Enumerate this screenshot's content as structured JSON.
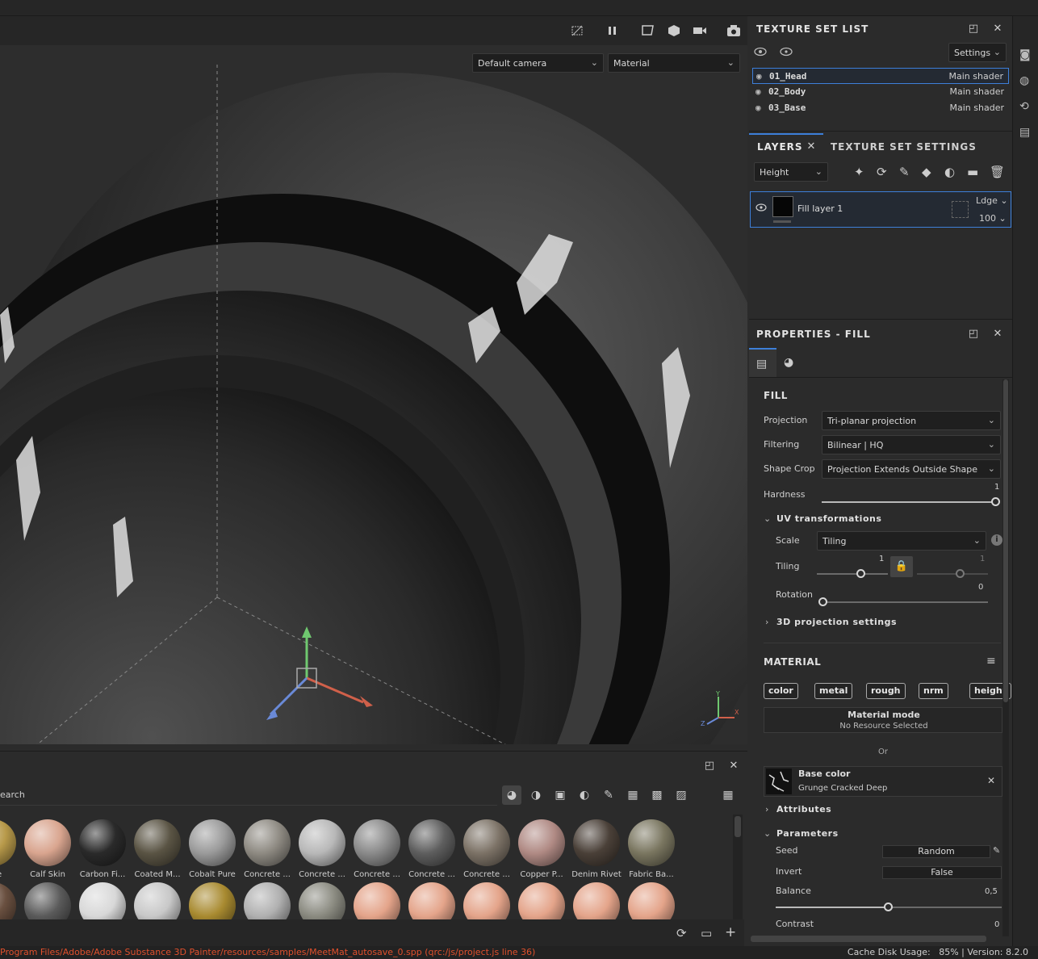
{
  "viewport": {
    "camera_select": "Default camera",
    "mode_select": "Material"
  },
  "texture_set_list": {
    "title": "TEXTURE SET LIST",
    "settings_label": "Settings",
    "rows": [
      {
        "name": "01_Head",
        "shader": "Main shader"
      },
      {
        "name": "02_Body",
        "shader": "Main shader"
      },
      {
        "name": "03_Base",
        "shader": "Main shader"
      }
    ]
  },
  "layers": {
    "tab_layers": "LAYERS",
    "tab_settings": "TEXTURE SET SETTINGS",
    "channel_select": "Height",
    "layer": {
      "name": "Fill layer 1",
      "blend": "Ldge",
      "opacity": "100"
    }
  },
  "properties": {
    "title": "PROPERTIES - FILL",
    "fill_heading": "FILL",
    "projection_label": "Projection",
    "projection_value": "Tri-planar projection",
    "filtering_label": "Filtering",
    "filtering_value": "Bilinear | HQ",
    "shape_crop_label": "Shape Crop",
    "shape_crop_value": "Projection Extends Outside Shape",
    "hardness_label": "Hardness",
    "hardness_value": "1",
    "hardness_level": 1.0,
    "uv_heading": "UV transformations",
    "scale_label": "Scale",
    "scale_value": "Tiling",
    "tiling_label": "Tiling",
    "tiling_value_a": "1",
    "tiling_value_b": "1",
    "rotation_label": "Rotation",
    "rotation_value": "0",
    "projection3d_heading": "3D projection settings",
    "material_heading": "MATERIAL",
    "channels": [
      "color",
      "metal",
      "rough",
      "nrm",
      "height"
    ],
    "material_mode_title": "Material mode",
    "material_mode_value": "No Resource Selected",
    "or_label": "Or",
    "base_color_title": "Base color",
    "base_color_resource": "Grunge Cracked Deep",
    "attributes_heading": "Attributes",
    "parameters_heading": "Parameters",
    "seed_label": "Seed",
    "seed_value": "Random",
    "invert_label": "Invert",
    "invert_value": "False",
    "balance_label": "Balance",
    "balance_value": "0,5",
    "balance_level": 0.5,
    "contrast_label": "Contrast",
    "contrast_value": "0"
  },
  "shelf": {
    "search_placeholder": "earch",
    "row1": [
      {
        "name": "Pure",
        "color": "#b89a4a"
      },
      {
        "name": "Calf Skin",
        "color": "#d9a58f"
      },
      {
        "name": "Carbon Fi...",
        "color": "#2a2a2a"
      },
      {
        "name": "Coated M...",
        "color": "#5a5444"
      },
      {
        "name": "Cobalt Pure",
        "color": "#9a9a9a"
      },
      {
        "name": "Concrete ...",
        "color": "#8e8a82"
      },
      {
        "name": "Concrete ...",
        "color": "#b8b8b8"
      },
      {
        "name": "Concrete ...",
        "color": "#8a8a8a"
      },
      {
        "name": "Concrete ...",
        "color": "#5e5e5e"
      },
      {
        "name": "Concrete ...",
        "color": "#7c7266"
      },
      {
        "name": "Copper P...",
        "color": "#b08a84"
      },
      {
        "name": "Denim Rivet",
        "color": "#4a4038"
      },
      {
        "name": "Fabric Ba...",
        "color": "#7a7660"
      }
    ],
    "row2": [
      {
        "color": "#6a5040"
      },
      {
        "color": "#5a5a5a"
      },
      {
        "color": "#d8d8d8"
      },
      {
        "color": "#c8c8c8"
      },
      {
        "color": "#a88a30"
      },
      {
        "color": "#b0b0b0"
      },
      {
        "color": "#8a8a80"
      },
      {
        "color": "#e4a48a"
      },
      {
        "color": "#e4a48a"
      },
      {
        "color": "#e4a48a"
      },
      {
        "color": "#e4a48a"
      },
      {
        "color": "#e4a48a"
      },
      {
        "color": "#e4a48a"
      }
    ]
  },
  "status": {
    "message": "Program Files/Adobe/Adobe Substance 3D Painter/resources/samples/MeetMat_autosave_0.spp (qrc:/js/project.js line 36)",
    "cache": "Cache Disk Usage:   85% | Version: 8.2.0"
  },
  "colors": {
    "accent": "#3d7fd9",
    "status_error": "#e0502c"
  }
}
